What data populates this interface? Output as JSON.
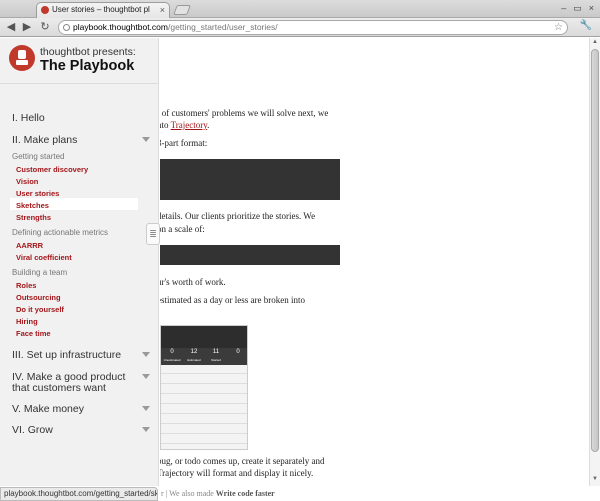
{
  "browser": {
    "tab_title": "User stories – thoughtbot pl",
    "tab_close": "×",
    "url_domain": "playbook.thoughtbot.com",
    "url_path": "/getting_started/user_stories/",
    "back": "◀",
    "forward": "▶",
    "reload": "↻",
    "star": "☆",
    "wrench": "🔧",
    "window_controls": [
      "–",
      "▭",
      "×"
    ]
  },
  "brand": {
    "presents": "thoughtbot presents:",
    "name": "The Playbook"
  },
  "sidebar": {
    "sections": [
      {
        "label": "I. Hello"
      },
      {
        "label": "II. Make plans"
      },
      {
        "label": "III. Set up infrastructure"
      },
      {
        "label": "IV. Make a good product"
      },
      {
        "label": "that customers want"
      },
      {
        "label": "V. Make money"
      },
      {
        "label": "VI. Grow"
      }
    ],
    "groups": [
      "Getting started",
      "Defining actionable metrics",
      "Building a team"
    ],
    "items": [
      "Customer discovery",
      "Vision",
      "User stories",
      "Sketches",
      "Strengths",
      "AARRR",
      "Viral coefficient",
      "Roles",
      "Outsourcing",
      "Do it yourself",
      "Hiring",
      "Face time"
    ],
    "resize_handle": "≣"
  },
  "content": {
    "line1": "t of customers' problems we will solve next, we",
    "line2_pre": "nto ",
    "line2_link": "Trajectory",
    "line2_post": ".",
    "line3": "3-part format:",
    "line4": "details. Our clients prioritize the stories. We",
    "line5": "on a scale of:",
    "line6": "ur's worth of work.",
    "line7": "estimated as a day or less are broken into",
    "line8": "bug, or todo comes up, create it separately and",
    "line9": "Trajectory will format and display it nicely."
  },
  "screenshot": {
    "stats": [
      {
        "value": "0",
        "label": "Unestimated"
      },
      {
        "value": "12",
        "label": "Estimated"
      },
      {
        "value": "11",
        "label": "Started"
      },
      {
        "value": "0",
        "label": ""
      }
    ]
  },
  "status": {
    "hover_url": "playbook.thoughtbot.com/getting_started/sketches/",
    "bottom_pre": "r | We also made ",
    "bottom_bold": "Write code faster"
  },
  "scroll": {
    "up": "▲",
    "down": "▼"
  }
}
